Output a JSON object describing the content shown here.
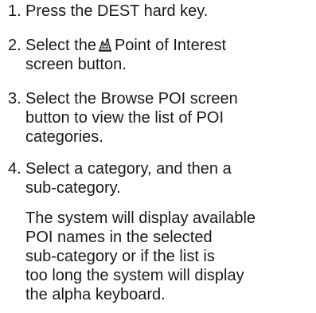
{
  "steps": [
    {
      "number": "1.",
      "lines": [
        "Press the DEST hard key."
      ]
    },
    {
      "number": "2.",
      "line1_before_icon": "Select the",
      "icon": "point-of-interest-icon",
      "line1_after_icon": "Point of Interest",
      "line2": "screen button."
    },
    {
      "number": "3.",
      "lines": [
        "Select the Browse POI screen",
        "button to view the list of POI",
        "categories."
      ]
    },
    {
      "number": "4.",
      "lines": [
        "Select a category, and then a",
        "sub-category."
      ]
    }
  ],
  "note_lines": [
    "The system will display available",
    "POI names in the selected",
    "sub-category or if the list is",
    "too long the system will display",
    "the alpha keyboard."
  ]
}
